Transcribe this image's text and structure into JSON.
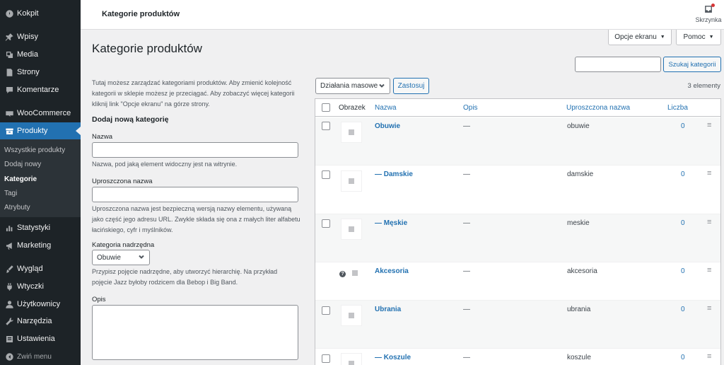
{
  "sidebar": {
    "items": [
      {
        "label": "Kokpit",
        "icon": "dashboard-icon"
      },
      {
        "label": "Wpisy",
        "icon": "pin-icon"
      },
      {
        "label": "Media",
        "icon": "media-icon"
      },
      {
        "label": "Strony",
        "icon": "page-icon"
      },
      {
        "label": "Komentarze",
        "icon": "comment-icon"
      },
      {
        "label": "WooCommerce",
        "icon": "woocommerce-icon"
      },
      {
        "label": "Produkty",
        "icon": "products-icon"
      },
      {
        "label": "Statystyki",
        "icon": "chart-icon"
      },
      {
        "label": "Marketing",
        "icon": "megaphone-icon"
      },
      {
        "label": "Wygląd",
        "icon": "brush-icon"
      },
      {
        "label": "Wtyczki",
        "icon": "plugin-icon"
      },
      {
        "label": "Użytkownicy",
        "icon": "users-icon"
      },
      {
        "label": "Narzędzia",
        "icon": "wrench-icon"
      },
      {
        "label": "Ustawienia",
        "icon": "settings-icon"
      },
      {
        "label": "Zwiń menu",
        "icon": "collapse-icon"
      }
    ],
    "submenu": [
      "Wszystkie produkty",
      "Dodaj nowy",
      "Kategorie",
      "Tagi",
      "Atrybuty"
    ],
    "active_color": "#2271b1"
  },
  "topbar": {
    "title": "Kategorie produktów",
    "inbox_label": "Skrzynka",
    "screen_options": "Opcje ekranu",
    "help": "Pomoc"
  },
  "page": {
    "title": "Kategorie produktów",
    "intro": "Tutaj możesz zarządzać kategoriami produktów. Aby zmienić kolejność kategorii w sklepie możesz je przeciągać. Aby zobaczyć więcej kategorii kliknij link \"Opcje ekranu\" na górze strony."
  },
  "form": {
    "heading": "Dodaj nową kategorię",
    "name_label": "Nazwa",
    "name_help": "Nazwa, pod jaką element widoczny jest na witrynie.",
    "slug_label": "Uproszczona nazwa",
    "slug_help": "Uproszczona nazwa jest bezpieczną wersją nazwy elementu, używaną jako część jego adresu URL. Zwykle składa się ona z małych liter alfabetu łacińskiego, cyfr i myślników.",
    "parent_label": "Kategoria nadrzędna",
    "parent_value": "Obuwie",
    "parent_help": "Przypisz pojęcie nadrzędne, aby utworzyć hierarchię. Na przykład pojęcie Jazz byłoby rodzicem dla Bebop i Big Band.",
    "desc_label": "Opis"
  },
  "toolbar": {
    "search_button": "Szukaj kategorii",
    "bulk_actions": "Działania masowe",
    "apply": "Zastosuj",
    "count": "3 elementy"
  },
  "table": {
    "headers": {
      "image": "Obrazek",
      "name": "Nazwa",
      "description": "Opis",
      "slug": "Uproszczona nazwa",
      "count": "Liczba"
    },
    "rows": [
      {
        "name": "Obuwie",
        "desc": "—",
        "slug": "obuwie",
        "count": "0"
      },
      {
        "name": "— Damskie",
        "desc": "—",
        "slug": "damskie",
        "count": "0"
      },
      {
        "name": "— Męskie",
        "desc": "—",
        "slug": "meskie",
        "count": "0"
      },
      {
        "name": "Akcesoria",
        "desc": "—",
        "slug": "akcesoria",
        "count": "0"
      },
      {
        "name": "Ubrania",
        "desc": "—",
        "slug": "ubrania",
        "count": "0"
      },
      {
        "name": "— Koszule",
        "desc": "—",
        "slug": "koszule",
        "count": "0"
      }
    ]
  }
}
